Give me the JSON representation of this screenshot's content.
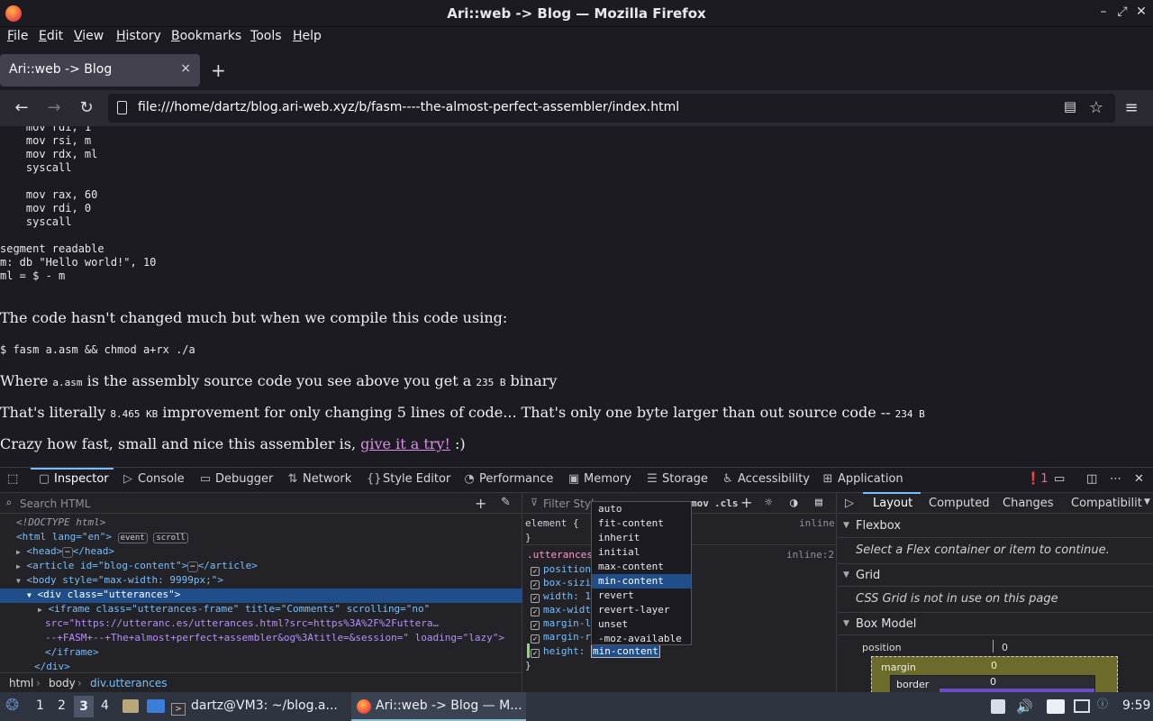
{
  "window": {
    "title": "Ari::web -> Blog — Mozilla Firefox"
  },
  "menu": [
    "File",
    "Edit",
    "View",
    "History",
    "Bookmarks",
    "Tools",
    "Help"
  ],
  "tab": {
    "label": "Ari::web -> Blog",
    "close": "×"
  },
  "nav": {
    "url": "file:///home/dartz/blog.ari-web.xyz/b/fasm----the-almost-perfect-assembler/index.html"
  },
  "page": {
    "code_block": "    mov rdi, 1\n    mov rsi, m\n    mov rdx, ml\n    syscall\n\n    mov rax, 60\n    mov rdi, 0\n    syscall\n\nsegment readable\nm: db \"Hello world!\", 10\nml = $ - m",
    "p1": "The code hasn't changed much but when we compile this code using:",
    "cmd": "$ fasm a.asm && chmod a+rx ./a",
    "p2_a": "Where ",
    "p2_code1": "a.asm",
    "p2_b": " is the assembly source code you see above you get a ",
    "p2_code2": "235 B",
    "p2_c": " binary",
    "p3_a": "That's literally ",
    "p3_code1": "8.465 KB",
    "p3_b": " improvement for only changing 5 lines of code... That's only one byte larger than out source code -- ",
    "p3_code2": "234 B",
    "p4_a": "Crazy how fast, small and nice this assembler is, ",
    "p4_link": "give it a try!",
    "p4_b": " :)"
  },
  "devtools": {
    "tabs": [
      "Inspector",
      "Console",
      "Debugger",
      "Network",
      "Style Editor",
      "Performance",
      "Memory",
      "Storage",
      "Accessibility",
      "Application"
    ],
    "error_count": "1",
    "search_placeholder": "Search HTML",
    "markup": {
      "doctype": "<!DOCTYPE html>",
      "html_open": "<html lang=\"en\">",
      "badge_event": "event",
      "badge_scroll": "scroll",
      "head": "<head>",
      "head_close": "</head>",
      "article": "<article id=\"blog-content\">",
      "article_close": "</article>",
      "body": "<body style=\"max-width: 9999px;\">",
      "div": "<div class=\"utterances\">",
      "iframe": "<iframe class=\"utterances-frame\" title=\"Comments\" scrolling=\"no\"",
      "iframe_src": "src=\"https://utteranc.es/utterances.html?src=https%3A%2F%2Futtera…",
      "iframe_src2": "--+FASM+--+The+almost+perfect+assembler&og%3Atitle=&session=\" loading=\"lazy\">",
      "iframe_close": "</iframe>",
      "div_close": "</div>"
    },
    "breadcrumb": [
      "html",
      "body",
      "div.utterances"
    ],
    "rules": {
      "filter_placeholder": "Filter Styl",
      "hov": "mov",
      "cls": ".cls",
      "element": "element {",
      "element_close": "}",
      "inline": "inline",
      "selector": ".utterances",
      "inline2": "inline:2",
      "props": [
        "position",
        "box-sizi",
        "width: 1",
        "max-widt",
        "margin-l",
        "margin-r"
      ],
      "height_name": "height:",
      "height_value": "min-content",
      "close": "}"
    },
    "dropdown": [
      "auto",
      "fit-content",
      "inherit",
      "initial",
      "max-content",
      "min-content",
      "revert",
      "revert-layer",
      "unset",
      "-moz-available"
    ],
    "dropdown_selected": "min-content",
    "layout_tabs": [
      "Layout",
      "Computed",
      "Changes",
      "Compatibilit"
    ],
    "flexbox": {
      "title": "Flexbox",
      "note": "Select a Flex container or item to continue."
    },
    "grid": {
      "title": "Grid",
      "note": "CSS Grid is not in use on this page"
    },
    "boxmodel": {
      "title": "Box Model",
      "position_label": "position",
      "position_value": "0",
      "margin_label": "margin",
      "margin_value": "0",
      "border_label": "border",
      "border_value": "0"
    }
  },
  "taskbar": {
    "workspaces": [
      "1",
      "2",
      "3",
      "4"
    ],
    "active_workspace": "3",
    "terminal": "dartz@VM3: ~/blog.a...",
    "firefox": "Ari::web -> Blog — M...",
    "clock": "9:59"
  }
}
